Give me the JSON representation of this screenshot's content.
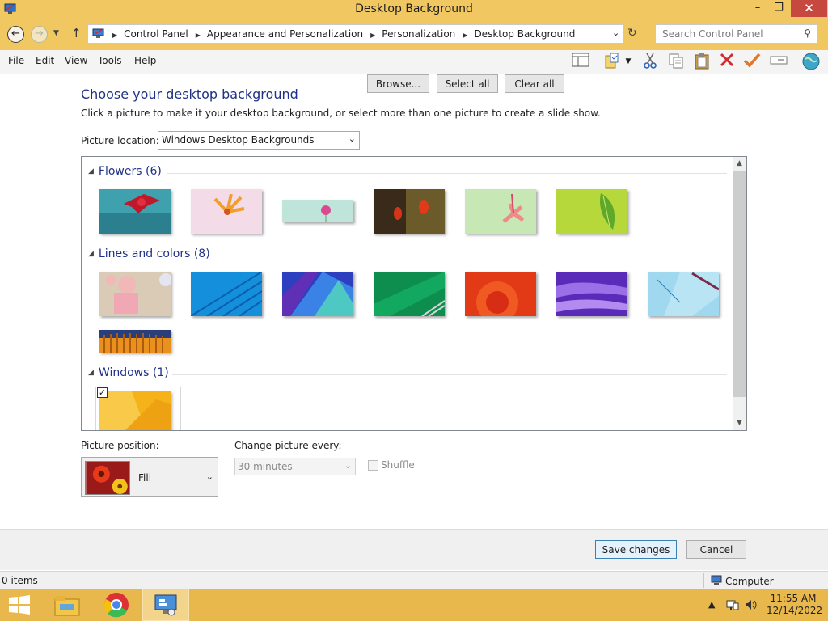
{
  "window": {
    "title": "Desktop Background",
    "min_glyph": "–",
    "max_glyph": "❐",
    "close_glyph": "✕"
  },
  "address": {
    "breadcrumbs": [
      "Control Panel",
      "Appearance and Personalization",
      "Personalization",
      "Desktop Background"
    ],
    "search_placeholder": "Search Control Panel"
  },
  "menu": {
    "items": [
      "File",
      "Edit",
      "View",
      "Tools",
      "Help"
    ]
  },
  "toolbar_icons": [
    "layout-pane-icon",
    "properties-icon",
    "cut-icon",
    "copy-icon",
    "paste-icon",
    "delete-icon",
    "check-icon",
    "rename-icon",
    "globe-icon"
  ],
  "page": {
    "heading": "Choose your desktop background",
    "subtext": "Click a picture to make it your desktop background, or select more than one picture to create a slide show.",
    "location_label": "Picture location:",
    "location_value": "Windows Desktop Backgrounds",
    "browse_label": "Browse...",
    "select_all_label": "Select all",
    "clear_all_label": "Clear all"
  },
  "gallery": {
    "groups": [
      {
        "name": "Flowers (6)",
        "thumbs": [
          "flowers-1",
          "flowers-2",
          "flowers-3",
          "flowers-4",
          "flowers-5",
          "flowers-6"
        ]
      },
      {
        "name": "Lines and colors (8)",
        "thumbs": [
          "lines-1",
          "lines-2",
          "lines-3",
          "lines-4",
          "lines-5",
          "lines-6",
          "lines-7",
          "lines-8"
        ]
      },
      {
        "name": "Windows (1)",
        "thumbs": [
          "windows-1"
        ],
        "checked": true
      }
    ]
  },
  "position": {
    "label": "Picture position:",
    "value": "Fill"
  },
  "slideshow": {
    "label": "Change picture every:",
    "value": "30 minutes",
    "shuffle_label": "Shuffle",
    "shuffle_checked": false
  },
  "actions": {
    "save_label": "Save changes",
    "cancel_label": "Cancel"
  },
  "status": {
    "items": "0 items",
    "zone": "Computer"
  },
  "taskbar": {
    "time": "11:55 AM",
    "date": "12/14/2022"
  },
  "colors": {
    "titlebar": "#f0c761",
    "taskbar": "#e9b84d",
    "heading_blue": "#1e3287",
    "close_red": "#c7483f"
  }
}
